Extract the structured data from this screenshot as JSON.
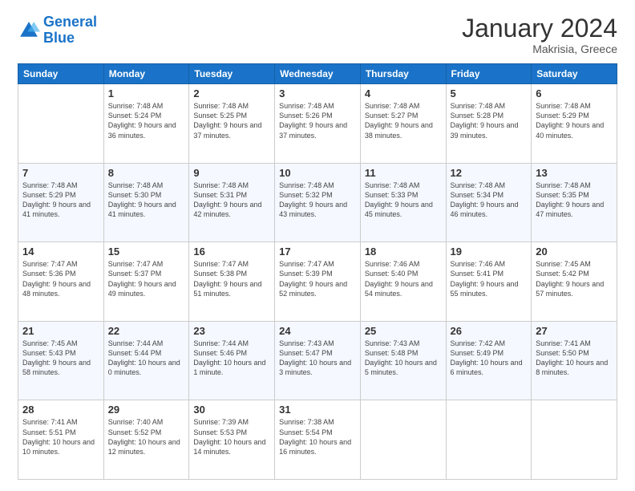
{
  "header": {
    "logo_line1": "General",
    "logo_line2": "Blue",
    "month_title": "January 2024",
    "subtitle": "Makrisia, Greece"
  },
  "days_of_week": [
    "Sunday",
    "Monday",
    "Tuesday",
    "Wednesday",
    "Thursday",
    "Friday",
    "Saturday"
  ],
  "weeks": [
    [
      {
        "day": "",
        "sunrise": "",
        "sunset": "",
        "daylight": ""
      },
      {
        "day": "1",
        "sunrise": "Sunrise: 7:48 AM",
        "sunset": "Sunset: 5:24 PM",
        "daylight": "Daylight: 9 hours and 36 minutes."
      },
      {
        "day": "2",
        "sunrise": "Sunrise: 7:48 AM",
        "sunset": "Sunset: 5:25 PM",
        "daylight": "Daylight: 9 hours and 37 minutes."
      },
      {
        "day": "3",
        "sunrise": "Sunrise: 7:48 AM",
        "sunset": "Sunset: 5:26 PM",
        "daylight": "Daylight: 9 hours and 37 minutes."
      },
      {
        "day": "4",
        "sunrise": "Sunrise: 7:48 AM",
        "sunset": "Sunset: 5:27 PM",
        "daylight": "Daylight: 9 hours and 38 minutes."
      },
      {
        "day": "5",
        "sunrise": "Sunrise: 7:48 AM",
        "sunset": "Sunset: 5:28 PM",
        "daylight": "Daylight: 9 hours and 39 minutes."
      },
      {
        "day": "6",
        "sunrise": "Sunrise: 7:48 AM",
        "sunset": "Sunset: 5:29 PM",
        "daylight": "Daylight: 9 hours and 40 minutes."
      }
    ],
    [
      {
        "day": "7",
        "sunrise": "Sunrise: 7:48 AM",
        "sunset": "Sunset: 5:29 PM",
        "daylight": "Daylight: 9 hours and 41 minutes."
      },
      {
        "day": "8",
        "sunrise": "Sunrise: 7:48 AM",
        "sunset": "Sunset: 5:30 PM",
        "daylight": "Daylight: 9 hours and 41 minutes."
      },
      {
        "day": "9",
        "sunrise": "Sunrise: 7:48 AM",
        "sunset": "Sunset: 5:31 PM",
        "daylight": "Daylight: 9 hours and 42 minutes."
      },
      {
        "day": "10",
        "sunrise": "Sunrise: 7:48 AM",
        "sunset": "Sunset: 5:32 PM",
        "daylight": "Daylight: 9 hours and 43 minutes."
      },
      {
        "day": "11",
        "sunrise": "Sunrise: 7:48 AM",
        "sunset": "Sunset: 5:33 PM",
        "daylight": "Daylight: 9 hours and 45 minutes."
      },
      {
        "day": "12",
        "sunrise": "Sunrise: 7:48 AM",
        "sunset": "Sunset: 5:34 PM",
        "daylight": "Daylight: 9 hours and 46 minutes."
      },
      {
        "day": "13",
        "sunrise": "Sunrise: 7:48 AM",
        "sunset": "Sunset: 5:35 PM",
        "daylight": "Daylight: 9 hours and 47 minutes."
      }
    ],
    [
      {
        "day": "14",
        "sunrise": "Sunrise: 7:47 AM",
        "sunset": "Sunset: 5:36 PM",
        "daylight": "Daylight: 9 hours and 48 minutes."
      },
      {
        "day": "15",
        "sunrise": "Sunrise: 7:47 AM",
        "sunset": "Sunset: 5:37 PM",
        "daylight": "Daylight: 9 hours and 49 minutes."
      },
      {
        "day": "16",
        "sunrise": "Sunrise: 7:47 AM",
        "sunset": "Sunset: 5:38 PM",
        "daylight": "Daylight: 9 hours and 51 minutes."
      },
      {
        "day": "17",
        "sunrise": "Sunrise: 7:47 AM",
        "sunset": "Sunset: 5:39 PM",
        "daylight": "Daylight: 9 hours and 52 minutes."
      },
      {
        "day": "18",
        "sunrise": "Sunrise: 7:46 AM",
        "sunset": "Sunset: 5:40 PM",
        "daylight": "Daylight: 9 hours and 54 minutes."
      },
      {
        "day": "19",
        "sunrise": "Sunrise: 7:46 AM",
        "sunset": "Sunset: 5:41 PM",
        "daylight": "Daylight: 9 hours and 55 minutes."
      },
      {
        "day": "20",
        "sunrise": "Sunrise: 7:45 AM",
        "sunset": "Sunset: 5:42 PM",
        "daylight": "Daylight: 9 hours and 57 minutes."
      }
    ],
    [
      {
        "day": "21",
        "sunrise": "Sunrise: 7:45 AM",
        "sunset": "Sunset: 5:43 PM",
        "daylight": "Daylight: 9 hours and 58 minutes."
      },
      {
        "day": "22",
        "sunrise": "Sunrise: 7:44 AM",
        "sunset": "Sunset: 5:44 PM",
        "daylight": "Daylight: 10 hours and 0 minutes."
      },
      {
        "day": "23",
        "sunrise": "Sunrise: 7:44 AM",
        "sunset": "Sunset: 5:46 PM",
        "daylight": "Daylight: 10 hours and 1 minute."
      },
      {
        "day": "24",
        "sunrise": "Sunrise: 7:43 AM",
        "sunset": "Sunset: 5:47 PM",
        "daylight": "Daylight: 10 hours and 3 minutes."
      },
      {
        "day": "25",
        "sunrise": "Sunrise: 7:43 AM",
        "sunset": "Sunset: 5:48 PM",
        "daylight": "Daylight: 10 hours and 5 minutes."
      },
      {
        "day": "26",
        "sunrise": "Sunrise: 7:42 AM",
        "sunset": "Sunset: 5:49 PM",
        "daylight": "Daylight: 10 hours and 6 minutes."
      },
      {
        "day": "27",
        "sunrise": "Sunrise: 7:41 AM",
        "sunset": "Sunset: 5:50 PM",
        "daylight": "Daylight: 10 hours and 8 minutes."
      }
    ],
    [
      {
        "day": "28",
        "sunrise": "Sunrise: 7:41 AM",
        "sunset": "Sunset: 5:51 PM",
        "daylight": "Daylight: 10 hours and 10 minutes."
      },
      {
        "day": "29",
        "sunrise": "Sunrise: 7:40 AM",
        "sunset": "Sunset: 5:52 PM",
        "daylight": "Daylight: 10 hours and 12 minutes."
      },
      {
        "day": "30",
        "sunrise": "Sunrise: 7:39 AM",
        "sunset": "Sunset: 5:53 PM",
        "daylight": "Daylight: 10 hours and 14 minutes."
      },
      {
        "day": "31",
        "sunrise": "Sunrise: 7:38 AM",
        "sunset": "Sunset: 5:54 PM",
        "daylight": "Daylight: 10 hours and 16 minutes."
      },
      {
        "day": "",
        "sunrise": "",
        "sunset": "",
        "daylight": ""
      },
      {
        "day": "",
        "sunrise": "",
        "sunset": "",
        "daylight": ""
      },
      {
        "day": "",
        "sunrise": "",
        "sunset": "",
        "daylight": ""
      }
    ]
  ]
}
